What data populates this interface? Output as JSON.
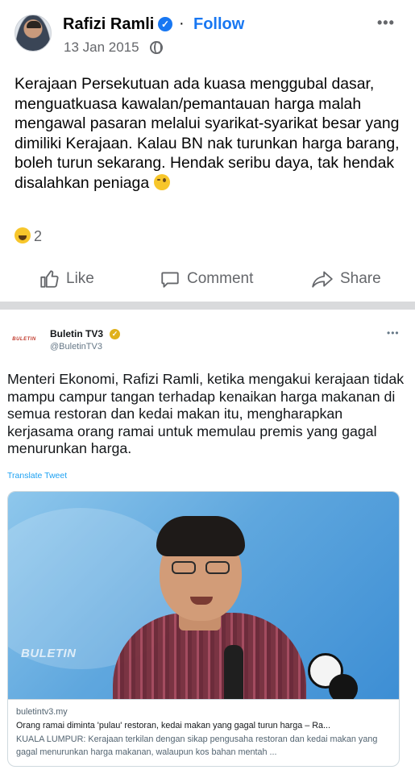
{
  "facebook_post": {
    "author": "Rafizi Ramli",
    "follow_label": "Follow",
    "date": "13 Jan 2015",
    "date_separator": "·",
    "more_icon": "more-horizontal-icon",
    "text": "Kerajaan Persekutuan ada kuasa menggubal dasar, menguatkuasa kawalan/pemantauan harga malah mengawal pasaran melalui syarikat-syarikat besar yang dimiliki Kerajaan. Kalau BN nak turunkan harga barang, boleh turun sekarang. Hendak seribu daya, tak hendak disalahkan peniaga",
    "reaction_icon": "haha-reaction-icon",
    "reaction_count": "2",
    "actions": {
      "like": "Like",
      "comment": "Comment",
      "share": "Share"
    },
    "colors": {
      "brand": "#1877f2",
      "muted": "#65676b"
    }
  },
  "tweet": {
    "logo_text": "BULETIN",
    "name": "Buletin TV3",
    "handle": "@BuletinTV3",
    "text": "Menteri Ekonomi, Rafizi Ramli, ketika mengakui kerajaan tidak mampu campur tangan terhadap kenaikan harga makanan di semua restoran dan kedai makan itu, mengharapkan kerjasama orang ramai untuk memulau premis yang gagal menurunkan harga.",
    "translate_label": "Translate Tweet",
    "link_card": {
      "watermark": "BULETIN",
      "domain": "buletintv3.my",
      "title": "Orang ramai diminta 'pulau' restoran, kedai makan yang gagal turun harga – Ra...",
      "description": "KUALA LUMPUR: Kerajaan terkilan dengan sikap pengusaha restoran dan kedai makan yang gagal menurunkan harga makanan, walaupun kos bahan mentah ..."
    },
    "colors": {
      "link": "#1da1f2",
      "badge": "#e0b11b"
    }
  }
}
